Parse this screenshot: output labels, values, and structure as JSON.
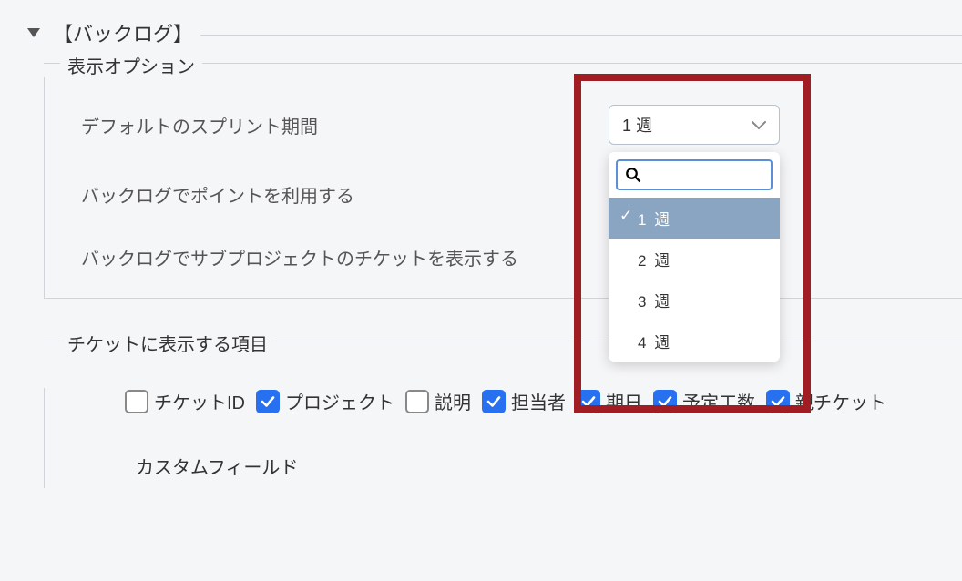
{
  "section": {
    "title": "【バックログ】"
  },
  "displayOptions": {
    "legend": "表示オプション",
    "rows": {
      "defaultSprint": "デフォルトのスプリント期間",
      "usePoints": "バックログでポイントを利用する",
      "showSubproject": "バックログでサブプロジェクトのチケットを表示する"
    },
    "sprintSelect": {
      "value": "1 週",
      "searchPlaceholder": "",
      "options": [
        "1 週",
        "2 週",
        "3 週",
        "4 週"
      ]
    }
  },
  "ticketFields": {
    "legend": "チケットに表示する項目",
    "items": [
      {
        "label": "チケットID",
        "checked": false
      },
      {
        "label": "プロジェクト",
        "checked": true
      },
      {
        "label": "説明",
        "checked": false
      },
      {
        "label": "担当者",
        "checked": true
      },
      {
        "label": "期日",
        "checked": true
      },
      {
        "label": "予定工数",
        "checked": true
      },
      {
        "label": "親チケット",
        "checked": true
      }
    ],
    "customFieldsLabel": "カスタムフィールド"
  }
}
